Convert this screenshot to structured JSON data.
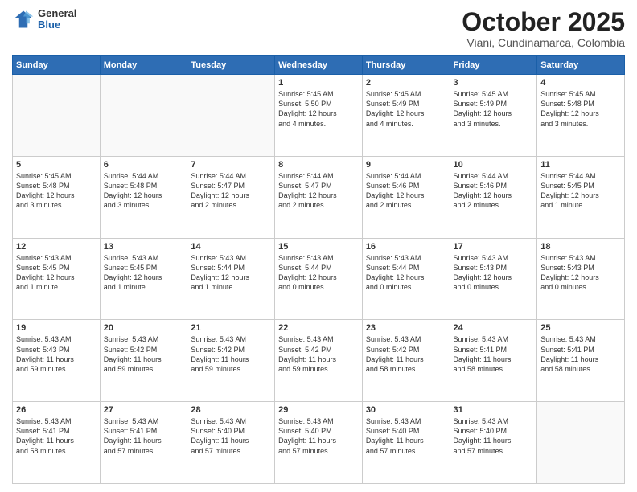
{
  "header": {
    "logo_general": "General",
    "logo_blue": "Blue",
    "month_title": "October 2025",
    "subtitle": "Viani, Cundinamarca, Colombia"
  },
  "weekdays": [
    "Sunday",
    "Monday",
    "Tuesday",
    "Wednesday",
    "Thursday",
    "Friday",
    "Saturday"
  ],
  "weeks": [
    [
      {
        "day": "",
        "info": ""
      },
      {
        "day": "",
        "info": ""
      },
      {
        "day": "",
        "info": ""
      },
      {
        "day": "1",
        "info": "Sunrise: 5:45 AM\nSunset: 5:50 PM\nDaylight: 12 hours\nand 4 minutes."
      },
      {
        "day": "2",
        "info": "Sunrise: 5:45 AM\nSunset: 5:49 PM\nDaylight: 12 hours\nand 4 minutes."
      },
      {
        "day": "3",
        "info": "Sunrise: 5:45 AM\nSunset: 5:49 PM\nDaylight: 12 hours\nand 3 minutes."
      },
      {
        "day": "4",
        "info": "Sunrise: 5:45 AM\nSunset: 5:48 PM\nDaylight: 12 hours\nand 3 minutes."
      }
    ],
    [
      {
        "day": "5",
        "info": "Sunrise: 5:45 AM\nSunset: 5:48 PM\nDaylight: 12 hours\nand 3 minutes."
      },
      {
        "day": "6",
        "info": "Sunrise: 5:44 AM\nSunset: 5:48 PM\nDaylight: 12 hours\nand 3 minutes."
      },
      {
        "day": "7",
        "info": "Sunrise: 5:44 AM\nSunset: 5:47 PM\nDaylight: 12 hours\nand 2 minutes."
      },
      {
        "day": "8",
        "info": "Sunrise: 5:44 AM\nSunset: 5:47 PM\nDaylight: 12 hours\nand 2 minutes."
      },
      {
        "day": "9",
        "info": "Sunrise: 5:44 AM\nSunset: 5:46 PM\nDaylight: 12 hours\nand 2 minutes."
      },
      {
        "day": "10",
        "info": "Sunrise: 5:44 AM\nSunset: 5:46 PM\nDaylight: 12 hours\nand 2 minutes."
      },
      {
        "day": "11",
        "info": "Sunrise: 5:44 AM\nSunset: 5:45 PM\nDaylight: 12 hours\nand 1 minute."
      }
    ],
    [
      {
        "day": "12",
        "info": "Sunrise: 5:43 AM\nSunset: 5:45 PM\nDaylight: 12 hours\nand 1 minute."
      },
      {
        "day": "13",
        "info": "Sunrise: 5:43 AM\nSunset: 5:45 PM\nDaylight: 12 hours\nand 1 minute."
      },
      {
        "day": "14",
        "info": "Sunrise: 5:43 AM\nSunset: 5:44 PM\nDaylight: 12 hours\nand 1 minute."
      },
      {
        "day": "15",
        "info": "Sunrise: 5:43 AM\nSunset: 5:44 PM\nDaylight: 12 hours\nand 0 minutes."
      },
      {
        "day": "16",
        "info": "Sunrise: 5:43 AM\nSunset: 5:44 PM\nDaylight: 12 hours\nand 0 minutes."
      },
      {
        "day": "17",
        "info": "Sunrise: 5:43 AM\nSunset: 5:43 PM\nDaylight: 12 hours\nand 0 minutes."
      },
      {
        "day": "18",
        "info": "Sunrise: 5:43 AM\nSunset: 5:43 PM\nDaylight: 12 hours\nand 0 minutes."
      }
    ],
    [
      {
        "day": "19",
        "info": "Sunrise: 5:43 AM\nSunset: 5:43 PM\nDaylight: 11 hours\nand 59 minutes."
      },
      {
        "day": "20",
        "info": "Sunrise: 5:43 AM\nSunset: 5:42 PM\nDaylight: 11 hours\nand 59 minutes."
      },
      {
        "day": "21",
        "info": "Sunrise: 5:43 AM\nSunset: 5:42 PM\nDaylight: 11 hours\nand 59 minutes."
      },
      {
        "day": "22",
        "info": "Sunrise: 5:43 AM\nSunset: 5:42 PM\nDaylight: 11 hours\nand 59 minutes."
      },
      {
        "day": "23",
        "info": "Sunrise: 5:43 AM\nSunset: 5:42 PM\nDaylight: 11 hours\nand 58 minutes."
      },
      {
        "day": "24",
        "info": "Sunrise: 5:43 AM\nSunset: 5:41 PM\nDaylight: 11 hours\nand 58 minutes."
      },
      {
        "day": "25",
        "info": "Sunrise: 5:43 AM\nSunset: 5:41 PM\nDaylight: 11 hours\nand 58 minutes."
      }
    ],
    [
      {
        "day": "26",
        "info": "Sunrise: 5:43 AM\nSunset: 5:41 PM\nDaylight: 11 hours\nand 58 minutes."
      },
      {
        "day": "27",
        "info": "Sunrise: 5:43 AM\nSunset: 5:41 PM\nDaylight: 11 hours\nand 57 minutes."
      },
      {
        "day": "28",
        "info": "Sunrise: 5:43 AM\nSunset: 5:40 PM\nDaylight: 11 hours\nand 57 minutes."
      },
      {
        "day": "29",
        "info": "Sunrise: 5:43 AM\nSunset: 5:40 PM\nDaylight: 11 hours\nand 57 minutes."
      },
      {
        "day": "30",
        "info": "Sunrise: 5:43 AM\nSunset: 5:40 PM\nDaylight: 11 hours\nand 57 minutes."
      },
      {
        "day": "31",
        "info": "Sunrise: 5:43 AM\nSunset: 5:40 PM\nDaylight: 11 hours\nand 57 minutes."
      },
      {
        "day": "",
        "info": ""
      }
    ]
  ]
}
